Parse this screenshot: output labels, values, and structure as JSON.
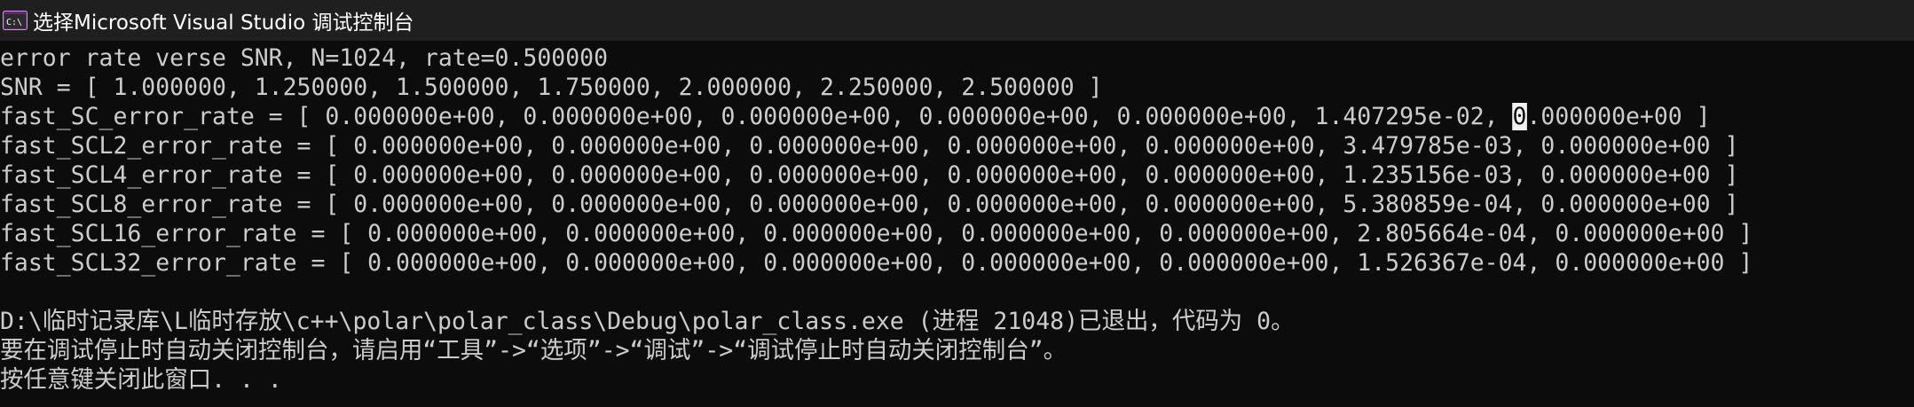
{
  "window": {
    "title": "选择Microsoft Visual Studio 调试控制台",
    "icon": "console-app-icon",
    "icon_label": "C:\\",
    "colors": {
      "titlebar_bg": "#1f1f1f",
      "console_bg": "#0c0c0c",
      "text": "#cccccc",
      "selection": "#f2f2f2",
      "icon_accent": "#68217a"
    }
  },
  "console": {
    "lines": [
      "error rate verse SNR, N=1024, rate=0.500000",
      "SNR = [ 1.000000, 1.250000, 1.500000, 1.750000, 2.000000, 2.250000, 2.500000 ]",
      "fast_SC_error_rate = [ 0.000000e+00, 0.000000e+00, 0.000000e+00, 0.000000e+00, 0.000000e+00, 1.407295e-02, 0.000000e+00 ]",
      "fast_SCL2_error_rate = [ 0.000000e+00, 0.000000e+00, 0.000000e+00, 0.000000e+00, 0.000000e+00, 3.479785e-03, 0.000000e+00 ]",
      "fast_SCL4_error_rate = [ 0.000000e+00, 0.000000e+00, 0.000000e+00, 0.000000e+00, 0.000000e+00, 1.235156e-03, 0.000000e+00 ]",
      "fast_SCL8_error_rate = [ 0.000000e+00, 0.000000e+00, 0.000000e+00, 0.000000e+00, 0.000000e+00, 5.380859e-04, 0.000000e+00 ]",
      "fast_SCL16_error_rate = [ 0.000000e+00, 0.000000e+00, 0.000000e+00, 0.000000e+00, 0.000000e+00, 2.805664e-04, 0.000000e+00 ]",
      "fast_SCL32_error_rate = [ 0.000000e+00, 0.000000e+00, 0.000000e+00, 0.000000e+00, 0.000000e+00, 1.526367e-04, 0.000000e+00 ]",
      "",
      "D:\\临时记录库\\L临时存放\\c++\\polar\\polar_class\\Debug\\polar_class.exe (进程 21048)已退出，代码为 0。",
      "要在调试停止时自动关闭控制台，请启用“工具”->“选项”->“调试”->“调试停止时自动关闭控制台”。",
      "按任意键关闭此窗口. . ."
    ],
    "selection": {
      "line_before": "fast_SC_error_rate = [ 0.000000e+00, 0.000000e+00, 0.000000e+00, 0.000000e+00, 0.000000e+00, 1.407295e-02, ",
      "selected_char": "0",
      "line_after": ".000000e+00 ]"
    }
  }
}
